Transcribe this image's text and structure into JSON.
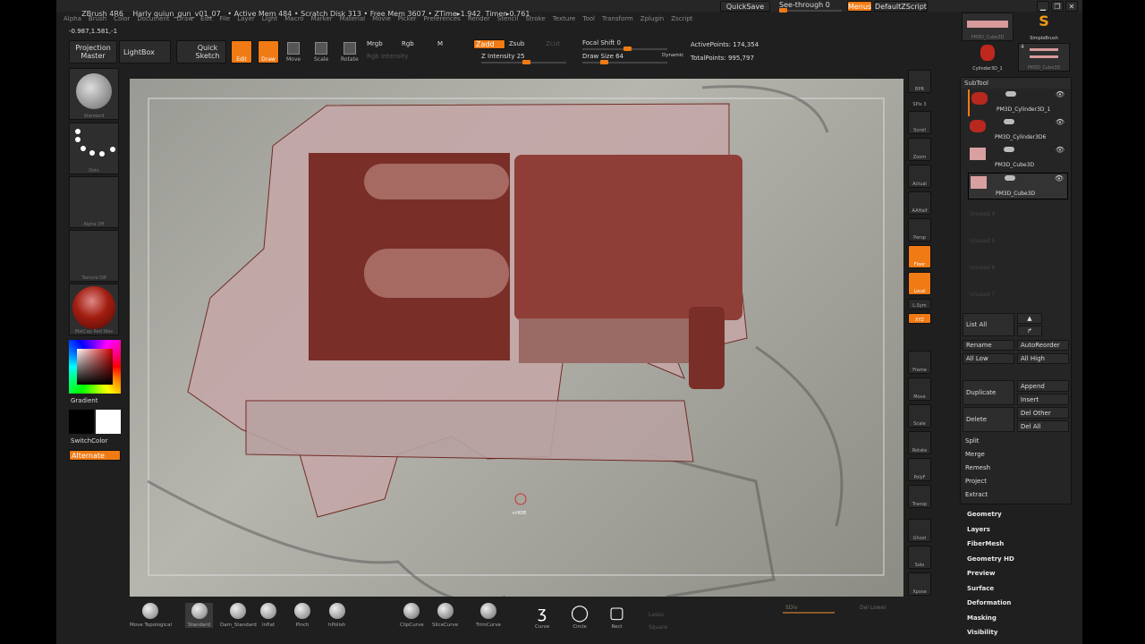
{
  "title_bar": {
    "text": "ZBrush 4R6    Harly quiun_gun_v01_07   • Active Mem 484 • Scratch Disk 313 • Free Mem 3607 • ZTime▸1.942  Timer▸0.761",
    "quicksave": "QuickSave",
    "see_through": "See-through  0",
    "see_through_value": 0,
    "menus": "Menus",
    "default_zscript": "DefaultZScript"
  },
  "menu_bar": [
    "Alpha",
    "Brush",
    "Color",
    "Document",
    "Draw",
    "Edit",
    "File",
    "Layer",
    "Light",
    "Macro",
    "Marker",
    "Material",
    "Movie",
    "Picker",
    "Preferences",
    "Render",
    "Stencil",
    "Stroke",
    "Texture",
    "Tool",
    "Transform",
    "Zplugin",
    "Zscript"
  ],
  "coords": "-0.987,1.581,-1",
  "toolbar": {
    "projection_master": "Projection Master",
    "lightbox": "LightBox",
    "quick_sketch": "Quick Sketch",
    "edit": "Edit",
    "draw": "Draw",
    "move": "Move",
    "scale": "Scale",
    "rotate": "Rotate",
    "mrgb": "Mrgb",
    "rgb": "Rgb",
    "m": "M",
    "rgb_intensity": "Rgb Intensity",
    "zadd": "Zadd",
    "zsub": "Zsub",
    "zcut": "Zcut",
    "z_intensity": "Z Intensity 25",
    "focal_shift": "Focal Shift 0",
    "draw_size": "Draw Size 64",
    "dynamic": "Dynamic",
    "active_points": "ActivePoints: 174,354",
    "total_points": "TotalPoints: 995,797"
  },
  "left_panel": {
    "brush": "Standard",
    "stroke": "Dots",
    "alpha": "Alpha Off",
    "texture": "Texture Off",
    "material": "MatCap Red Wax",
    "gradient": "Gradient",
    "switch_color": "SwitchColor",
    "alternate": "Alternate"
  },
  "right_shelf": [
    "BPR",
    "SPix 3",
    "Scroll",
    "Zoom",
    "Actual",
    "AAHalf",
    "Persp",
    "Floor",
    "Local",
    "L.Sym",
    "XYZ",
    "Frame",
    "Move",
    "Scale",
    "Rotate",
    "PolyF",
    "Transp",
    "Ghost",
    "Solo",
    "Xpose"
  ],
  "tool_thumbs": [
    "PM3D_Cube3D",
    "SimpleBrush",
    "Cylinder3D_1",
    "PM3D_Cube3D"
  ],
  "tool_thumb_count": "4",
  "subtool": {
    "title": "SubTool",
    "items": [
      "PM3D_Cylinder3D_1",
      "PM3D_Cylinder3D6",
      "PM3D_Cube3D",
      "PM3D_Cube3D"
    ],
    "unused": [
      "Unused 4",
      "Unused 5",
      "Unused 6",
      "Unused 7"
    ],
    "list_all": "List All",
    "rename": "Rename",
    "autoreorder": "AutoReorder",
    "all_low": "All Low",
    "all_high": "All High",
    "duplicate": "Duplicate",
    "append": "Append",
    "insert": "Insert",
    "delete": "Delete",
    "del_other": "Del Other",
    "del_all": "Del All",
    "split": "Split",
    "merge": "Merge",
    "remesh": "Remesh",
    "project": "Project",
    "extract": "Extract"
  },
  "sections": [
    "Geometry",
    "Layers",
    "FiberMesh",
    "Geometry HD",
    "Preview",
    "Surface",
    "Deformation",
    "Masking",
    "Visibility"
  ],
  "bottom_shelf": {
    "brushes": [
      "Move Topological",
      "Standard",
      "Dam_Standard",
      "Inflat",
      "Pinch",
      "hPolish"
    ],
    "curves": [
      "ClipCurve",
      "SliceCurve",
      "TrimCurve"
    ],
    "shapes": [
      "Curve",
      "Circle",
      "Rect"
    ],
    "lasso": "Lasso",
    "square": "Square",
    "sdiv": "SDiv",
    "del_lower": "Del Lower"
  },
  "cursor_label": "+HIDE"
}
